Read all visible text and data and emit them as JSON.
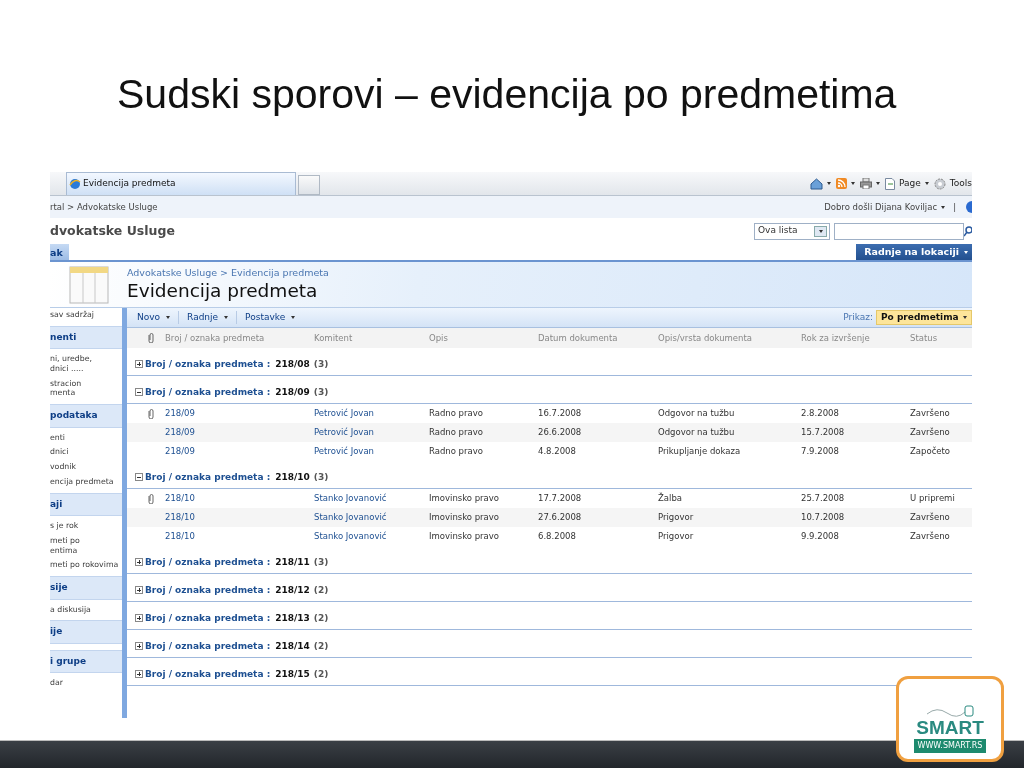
{
  "slide": {
    "title": "Sudski sporovi – evidencija po predmetima"
  },
  "browser": {
    "tab": "Evidencija predmeta",
    "tools": [
      {
        "kind": "home"
      },
      {
        "kind": "feed"
      },
      {
        "kind": "print"
      },
      {
        "kind": "page",
        "label": "Page"
      },
      {
        "kind": "tools",
        "label": "Tools"
      }
    ]
  },
  "top_bar": {
    "breadcrumb": "rtal > Advokatske Usluge",
    "welcome": "Dobro došli Dijana Koviljac",
    "separator": "|"
  },
  "site": {
    "title": "dvokatske Usluge",
    "scope": "Ova lista"
  },
  "tabs": [
    {
      "label": "ak",
      "selected": true
    }
  ],
  "site_actions": "Radnje na lokaciji",
  "page": {
    "breadcrumb": "Advokatske Usluge > Evidencija predmeta",
    "title": "Evidencija predmeta"
  },
  "quick_launch": [
    {
      "kind": "item",
      "label": "sav sadržaj"
    },
    {
      "kind": "heading",
      "label": "nenti"
    },
    {
      "kind": "item",
      "label": "ni, uredbe,\ndnici ....."
    },
    {
      "kind": "item",
      "label": "stracion\nmenta"
    },
    {
      "kind": "heading",
      "label": "podataka"
    },
    {
      "kind": "item",
      "label": "enti"
    },
    {
      "kind": "item",
      "label": "dnici"
    },
    {
      "kind": "item",
      "label": "vodnik"
    },
    {
      "kind": "item",
      "label": "encija predmeta"
    },
    {
      "kind": "heading",
      "label": "aji"
    },
    {
      "kind": "item",
      "label": "s je rok"
    },
    {
      "kind": "item",
      "label": "meti po\nentima"
    },
    {
      "kind": "item",
      "label": "meti po rokovima"
    },
    {
      "kind": "heading",
      "label": "sije"
    },
    {
      "kind": "item",
      "label": "a diskusija"
    },
    {
      "kind": "heading",
      "label": "ije"
    },
    {
      "kind": "heading",
      "label": "i grupe"
    },
    {
      "kind": "item",
      "label": "dar"
    }
  ],
  "toolbar": {
    "menus": [
      "Novo",
      "Radnje",
      "Postavke"
    ],
    "view_label": "Prikaz:",
    "view": "Po predmetima"
  },
  "table": {
    "columns": [
      "Broj / oznaka predmeta",
      "Komitent",
      "Opis",
      "Datum dokumenta",
      "Opis/vrsta dokumenta",
      "Rok za izvršenje",
      "Status"
    ],
    "groups": [
      {
        "label": "Broj / oznaka predmeta :",
        "value": "218/08",
        "count": "(3)",
        "expanded": false
      },
      {
        "label": "Broj / oznaka predmeta :",
        "value": "218/09",
        "count": "(3)",
        "expanded": true,
        "rows": [
          {
            "attachment": true,
            "cells": [
              "218/09",
              "Petrović Jovan",
              "Radno pravo",
              "16.7.2008",
              "Odgovor na tužbu",
              "2.8.2008",
              "Završeno"
            ]
          },
          {
            "attachment": false,
            "cells": [
              "218/09",
              "Petrović Jovan",
              "Radno pravo",
              "26.6.2008",
              "Odgovor na tužbu",
              "15.7.2008",
              "Završeno"
            ]
          },
          {
            "attachment": false,
            "cells": [
              "218/09",
              "Petrović Jovan",
              "Radno pravo",
              "4.8.2008",
              "Prikupljanje dokaza",
              "7.9.2008",
              "Započeto"
            ]
          }
        ]
      },
      {
        "label": "Broj / oznaka predmeta :",
        "value": "218/10",
        "count": "(3)",
        "expanded": true,
        "rows": [
          {
            "attachment": true,
            "cells": [
              "218/10",
              "Stanko Jovanović",
              "Imovinsko pravo",
              "17.7.2008",
              "Žalba",
              "25.7.2008",
              "U pripremi"
            ]
          },
          {
            "attachment": false,
            "cells": [
              "218/10",
              "Stanko Jovanović",
              "Imovinsko pravo",
              "27.6.2008",
              "Prigovor",
              "10.7.2008",
              "Završeno"
            ]
          },
          {
            "attachment": false,
            "cells": [
              "218/10",
              "Stanko Jovanović",
              "Imovinsko pravo",
              "6.8.2008",
              "Prigovor",
              "9.9.2008",
              "Završeno"
            ]
          }
        ]
      },
      {
        "label": "Broj / oznaka predmeta :",
        "value": "218/11",
        "count": "(3)",
        "expanded": false
      },
      {
        "label": "Broj / oznaka predmeta :",
        "value": "218/12",
        "count": "(2)",
        "expanded": false
      },
      {
        "label": "Broj / oznaka predmeta :",
        "value": "218/13",
        "count": "(2)",
        "expanded": false
      },
      {
        "label": "Broj / oznaka predmeta :",
        "value": "218/14",
        "count": "(2)",
        "expanded": false
      },
      {
        "label": "Broj / oznaka predmeta :",
        "value": "218/15",
        "count": "(2)",
        "expanded": false
      }
    ]
  },
  "logo": {
    "name": "SMART",
    "url": "WWW.SMART.RS"
  }
}
